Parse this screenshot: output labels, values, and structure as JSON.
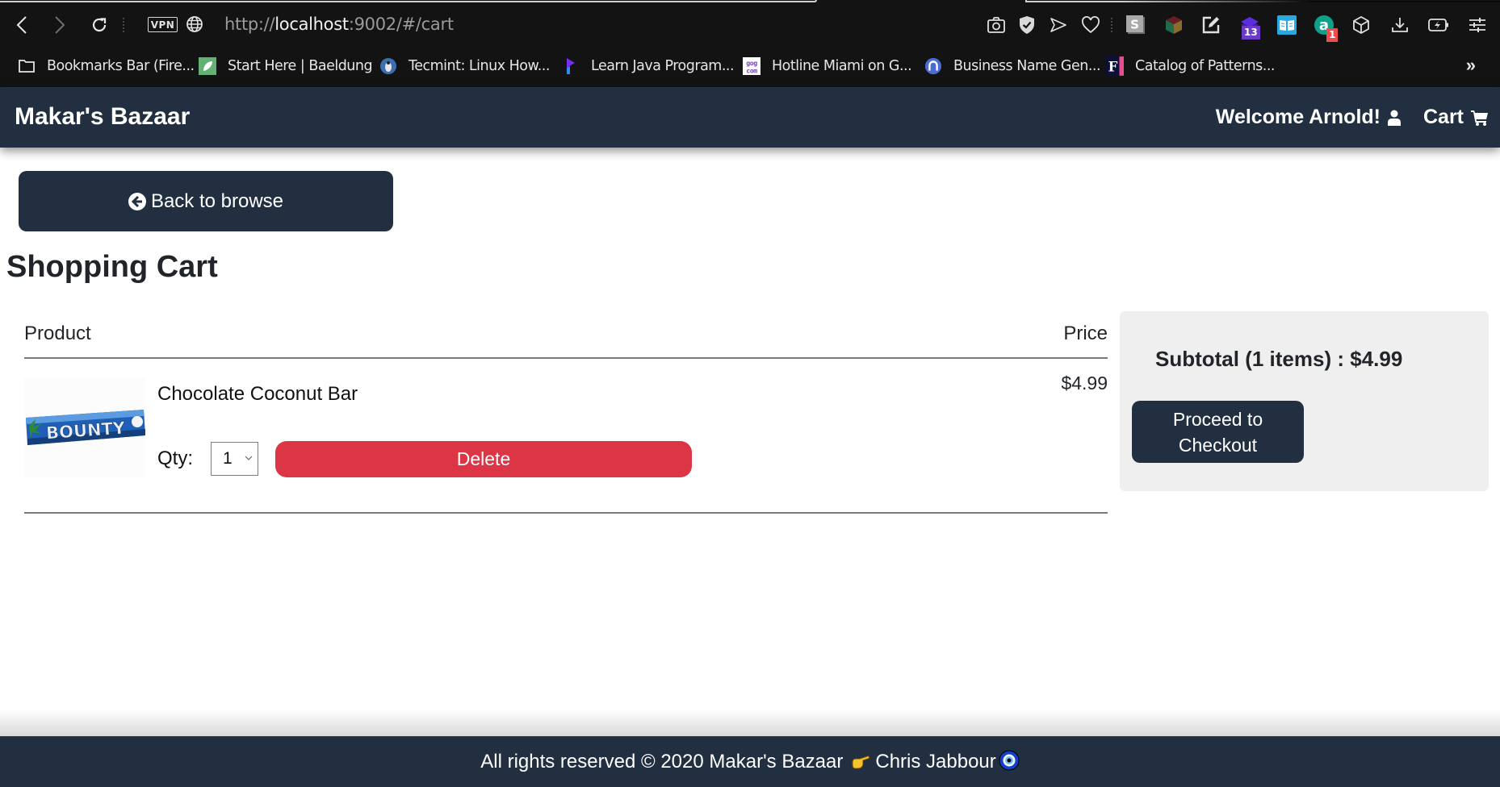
{
  "browser": {
    "url_scheme": "http://",
    "url_host": "localhost",
    "url_rest": ":9002/#/cart",
    "vpn_label": "VPN",
    "toolbar_icons": [
      {
        "name": "camera-icon"
      },
      {
        "name": "shield-check-icon"
      },
      {
        "name": "send-icon"
      },
      {
        "name": "heart-icon"
      },
      {
        "name": "s-extension-icon"
      },
      {
        "name": "cube-extension-icon"
      },
      {
        "name": "edit-note-icon"
      },
      {
        "name": "stack-extension-icon",
        "badge": "13"
      },
      {
        "name": "reader-icon"
      },
      {
        "name": "a-extension-icon",
        "badge": "1"
      },
      {
        "name": "box-icon"
      },
      {
        "name": "download-icon"
      },
      {
        "name": "battery-saver-icon"
      },
      {
        "name": "settings-sliders-icon"
      }
    ],
    "bookmarks": [
      {
        "label": "Bookmarks Bar (Fire...",
        "icon": "folder-icon"
      },
      {
        "label": "Start Here | Baeldung",
        "icon": "baeldung-icon"
      },
      {
        "label": "Tecmint: Linux How...",
        "icon": "tecmint-icon"
      },
      {
        "label": "Learn Java Program...",
        "icon": "learn-java-icon"
      },
      {
        "label": "Hotline Miami on G...",
        "icon": "gog-icon"
      },
      {
        "label": "Business Name Gen...",
        "icon": "business-name-icon"
      },
      {
        "label": "Catalog of Patterns...",
        "icon": "fowler-icon"
      }
    ],
    "more_bookmarks": "»"
  },
  "navbar": {
    "brand": "Makar's Bazaar",
    "welcome": "Welcome Arnold!",
    "cart": "Cart"
  },
  "main": {
    "back_button": "Back to browse",
    "title": "Shopping Cart",
    "table": {
      "headers": {
        "product": "Product",
        "price": "Price"
      },
      "rows": [
        {
          "name": "Chocolate Coconut Bar",
          "image_alt": "Bounty bar",
          "image_text": "BOUNTY",
          "qty_label": "Qty:",
          "qty": "1",
          "delete_label": "Delete",
          "price": "$4.99"
        }
      ]
    },
    "summary": {
      "subtotal": "Subtotal (1 items) : $4.99",
      "checkout_button": "Proceed to Checkout"
    }
  },
  "footer": {
    "text": "All rights reserved © 2020 Makar's Bazaar",
    "author": "Chris Jabbour"
  },
  "colors": {
    "navbar_bg": "#212f41",
    "delete": "#dc3545",
    "summary_bg": "#efefef"
  }
}
